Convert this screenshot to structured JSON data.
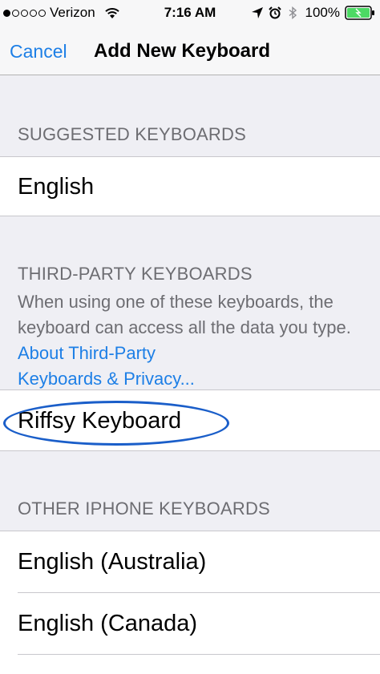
{
  "status_bar": {
    "carrier": "Verizon",
    "time": "7:16 AM",
    "battery": "100%",
    "signal_icon": "signal-dots-icon",
    "wifi_icon": "wifi-icon",
    "location_icon": "location-arrow-icon",
    "alarm_icon": "alarm-icon",
    "bluetooth_icon": "bluetooth-icon",
    "battery_icon": "battery-icon"
  },
  "nav": {
    "cancel_label": "Cancel",
    "title": "Add New Keyboard"
  },
  "sections": {
    "suggested": {
      "header": "SUGGESTED KEYBOARDS",
      "items": [
        "English"
      ]
    },
    "third_party": {
      "header": "THIRD-PARTY KEYBOARDS",
      "footer_text": "When using one of these keyboards, the keyboard can access all the data you type.",
      "footer_link_line1": "About Third-Party",
      "footer_link_line2": "Keyboards & Privacy...",
      "items": [
        "Riffsy Keyboard"
      ]
    },
    "other": {
      "header": "OTHER IPHONE KEYBOARDS",
      "items": [
        "English (Australia)",
        "English (Canada)"
      ]
    }
  },
  "colors": {
    "accent": "#1d7fe6",
    "highlight": "#1a5ec9",
    "battery_green": "#4cd964"
  }
}
